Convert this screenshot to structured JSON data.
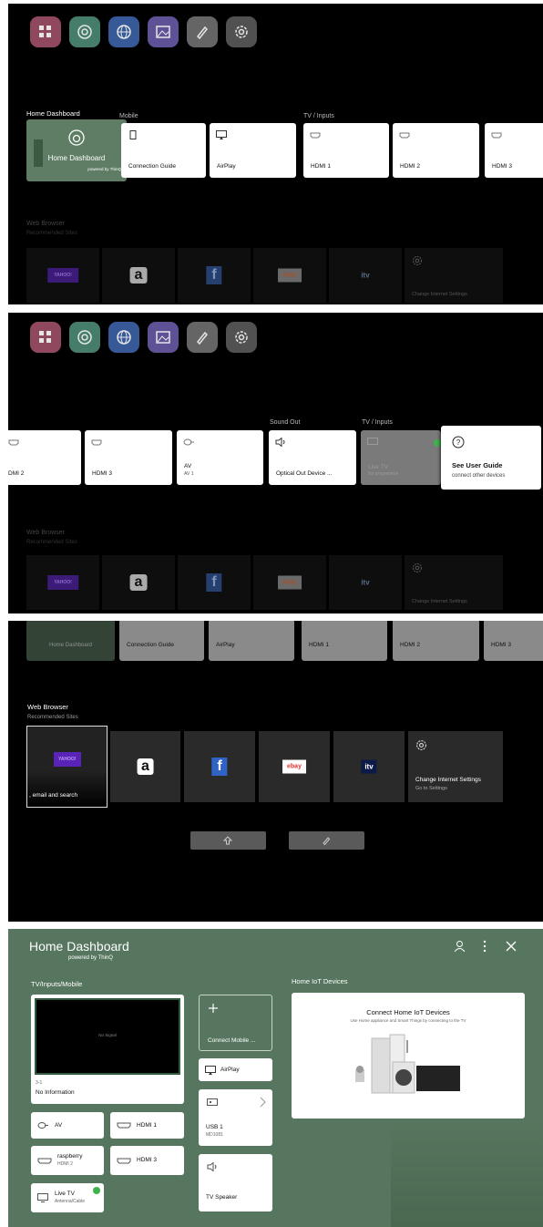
{
  "screens": {
    "launcher_top": {
      "sections": {
        "home_dashboard": "Home Dashboard",
        "mobile": "Mobile",
        "tv_inputs": "TV / Inputs",
        "web_browser": "Web Browser",
        "recommended": "Recommended Sites"
      },
      "home_dashboard_card": {
        "title": "Home Dashboard",
        "powered": "powered by ThinQ"
      },
      "mobile_cards": [
        "Connection Guide",
        "AirPlay"
      ],
      "input_cards": [
        "HDMI 1",
        "HDMI 2",
        "HDMI 3"
      ],
      "settings_tile": "Change Internet Settings"
    },
    "launcher_scrolled": {
      "sections": {
        "sound_out": "Sound Out",
        "tv_inputs": "TV / Inputs",
        "web_browser": "Web Browser",
        "recommended": "Recommended Sites"
      },
      "cards": [
        {
          "label": "DMI 2",
          "sub": ""
        },
        {
          "label": "HDMI 3",
          "sub": ""
        },
        {
          "label": "AV",
          "sub": "AV 1"
        },
        {
          "label": "Optical Out Device ...",
          "sub": ""
        }
      ],
      "live_tv": {
        "label": "Live TV",
        "sub": "No programme"
      },
      "guide": {
        "label": "See User Guide",
        "sub": "connect other devices"
      },
      "settings_tile": "Change Internet Settings"
    },
    "launcher_web": {
      "top_cards": [
        "Home Dashboard",
        "Connection Guide",
        "AirPlay",
        "HDMI 1",
        "HDMI 2",
        "HDMI 3"
      ],
      "sections": {
        "web_browser": "Web Browser",
        "recommended": "Recommended Sites"
      },
      "yahoo_caption": ", email and search",
      "settings_tile": {
        "title": "Change Internet Settings",
        "sub": "Go to Settings"
      }
    },
    "home_dashboard": {
      "title": "Home Dashboard",
      "powered": "powered by ThinQ",
      "section_inputs": "TV/Inputs/Mobile",
      "section_iot": "Home IoT Devices",
      "preview": {
        "signal": "No Signal",
        "channel": "3-1",
        "info": "No Information"
      },
      "inputs": [
        {
          "label": "AV",
          "sub": ""
        },
        {
          "label": "HDMI 1",
          "sub": ""
        },
        {
          "label": "raspberry",
          "sub": "HDMI 2"
        },
        {
          "label": "HDMI 3",
          "sub": ""
        },
        {
          "label": "Live TV",
          "sub": "Antenna/Cable"
        }
      ],
      "mobile": {
        "connect": "Connect Mobile ...",
        "airplay": "AirPlay",
        "usb": "USB 1",
        "usb_sub": "MD1081",
        "speaker": "TV Speaker"
      },
      "iot": {
        "title": "Connect Home IoT Devices",
        "desc": "Use Home appliance and Smart Things by connecting to the TV"
      }
    }
  },
  "logos": {
    "yahoo": "YAHOO!",
    "amazon": "a",
    "facebook": "f",
    "ebay": "ebay",
    "itv": "itv"
  }
}
